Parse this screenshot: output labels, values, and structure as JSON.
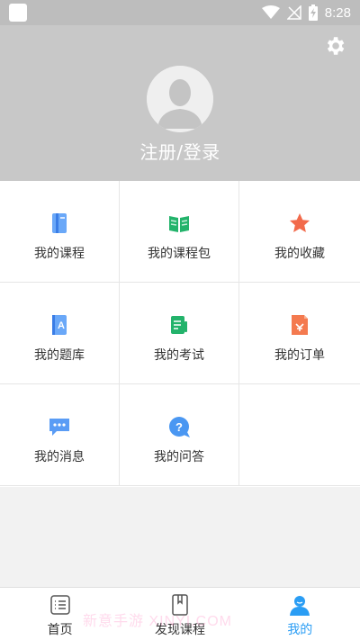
{
  "status_bar": {
    "time": "8:28"
  },
  "profile": {
    "login_text": "注册/登录"
  },
  "menu": [
    {
      "label": "我的课程",
      "icon": "course-book-icon"
    },
    {
      "label": "我的课程包",
      "icon": "course-package-icon"
    },
    {
      "label": "我的收藏",
      "icon": "star-icon"
    },
    {
      "label": "我的题库",
      "icon": "question-bank-icon"
    },
    {
      "label": "我的考试",
      "icon": "exam-icon"
    },
    {
      "label": "我的订单",
      "icon": "order-icon"
    },
    {
      "label": "我的消息",
      "icon": "message-icon"
    },
    {
      "label": "我的问答",
      "icon": "question-icon"
    }
  ],
  "tabs": [
    {
      "label": "首页",
      "icon": "home-list-icon"
    },
    {
      "label": "发现课程",
      "icon": "discover-book-icon"
    },
    {
      "label": "我的",
      "icon": "person-icon",
      "active": true
    }
  ],
  "watermark": "新意手游  XINYI.COM",
  "colors": {
    "accent": "#2a9df4",
    "header_bg": "#c8c8c8"
  }
}
